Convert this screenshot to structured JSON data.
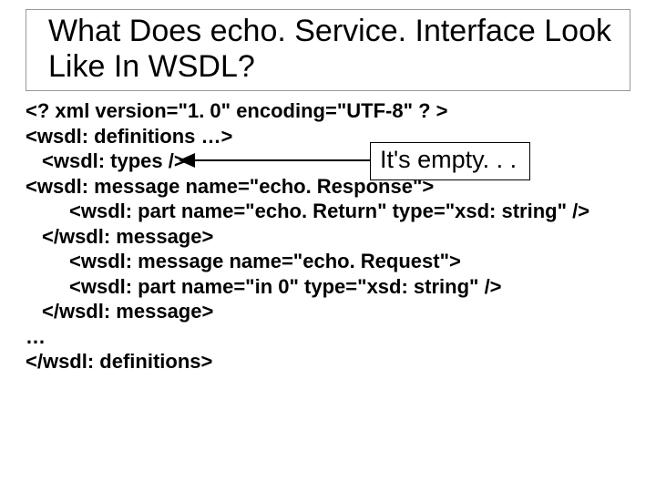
{
  "title": "What Does echo. Service. Interface Look Like In WSDL?",
  "code": {
    "l1": "<? xml version=\"1. 0\" encoding=\"UTF-8\" ? >",
    "l2": "<wsdl: definitions …>",
    "l3": "<wsdl: types />",
    "l4": "<wsdl: message name=\"echo. Response\">",
    "l5": "<wsdl: part name=\"echo. Return\" type=\"xsd: string\" />",
    "l6": "</wsdl: message>",
    "l7": "<wsdl: message name=\"echo. Request\">",
    "l8": "<wsdl: part name=\"in 0\" type=\"xsd: string\" />",
    "l9": "</wsdl: message>",
    "l10": "…",
    "l11": "</wsdl: definitions>"
  },
  "annotation": "It's empty. . ."
}
